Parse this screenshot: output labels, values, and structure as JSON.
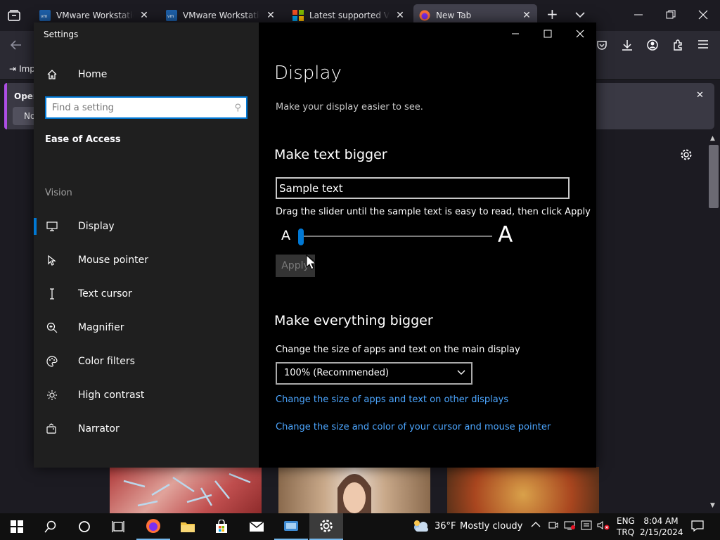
{
  "browser": {
    "tabs": [
      {
        "title": "VMware Workstation Pl",
        "icon": "vmware-icon",
        "active": false
      },
      {
        "title": "VMware Workstation Pl",
        "icon": "vmware-icon",
        "active": false
      },
      {
        "title": "Latest supported Visual",
        "icon": "microsoft-icon",
        "active": false
      },
      {
        "title": "New Tab",
        "icon": "firefox-icon",
        "active": true
      }
    ],
    "bookmark_partial": "Imp",
    "notification_partial_title": "Oper",
    "notification_partial_button": "No"
  },
  "settings": {
    "window_title": "Settings",
    "home_label": "Home",
    "search_placeholder": "Find a setting",
    "section_title": "Ease of Access",
    "group_label": "Vision",
    "nav_items": [
      {
        "label": "Display",
        "icon": "monitor-icon",
        "selected": true
      },
      {
        "label": "Mouse pointer",
        "icon": "mouse-pointer-icon",
        "selected": false
      },
      {
        "label": "Text cursor",
        "icon": "text-cursor-icon",
        "selected": false
      },
      {
        "label": "Magnifier",
        "icon": "magnifier-icon",
        "selected": false
      },
      {
        "label": "Color filters",
        "icon": "color-filters-icon",
        "selected": false
      },
      {
        "label": "High contrast",
        "icon": "high-contrast-icon",
        "selected": false
      },
      {
        "label": "Narrator",
        "icon": "narrator-icon",
        "selected": false
      }
    ],
    "page_title": "Display",
    "page_subtitle": "Make your display easier to see.",
    "text_bigger": {
      "heading": "Make text bigger",
      "sample_text": "Sample text",
      "instruction": "Drag the slider until the sample text is easy to read, then click Apply",
      "slider_min_label": "A",
      "slider_max_label": "A",
      "slider_value_fraction": 0.0,
      "apply_label": "Apply"
    },
    "everything_bigger": {
      "heading": "Make everything bigger",
      "description": "Change the size of apps and text on the main display",
      "scale_value": "100% (Recommended)",
      "link_other_displays": "Change the size of apps and text on other displays",
      "link_cursor": "Change the size and color of your cursor and mouse pointer"
    }
  },
  "taskbar": {
    "weather_temp": "36°F",
    "weather_text": "Mostly cloudy",
    "lang_top": "ENG",
    "lang_bottom": "TRQ",
    "time": "8:04 AM",
    "date": "2/15/2024"
  },
  "colors": {
    "accent_blue": "#0078d4",
    "link_blue": "#4ca6ff",
    "purple_accent": "#ad4ee4"
  }
}
